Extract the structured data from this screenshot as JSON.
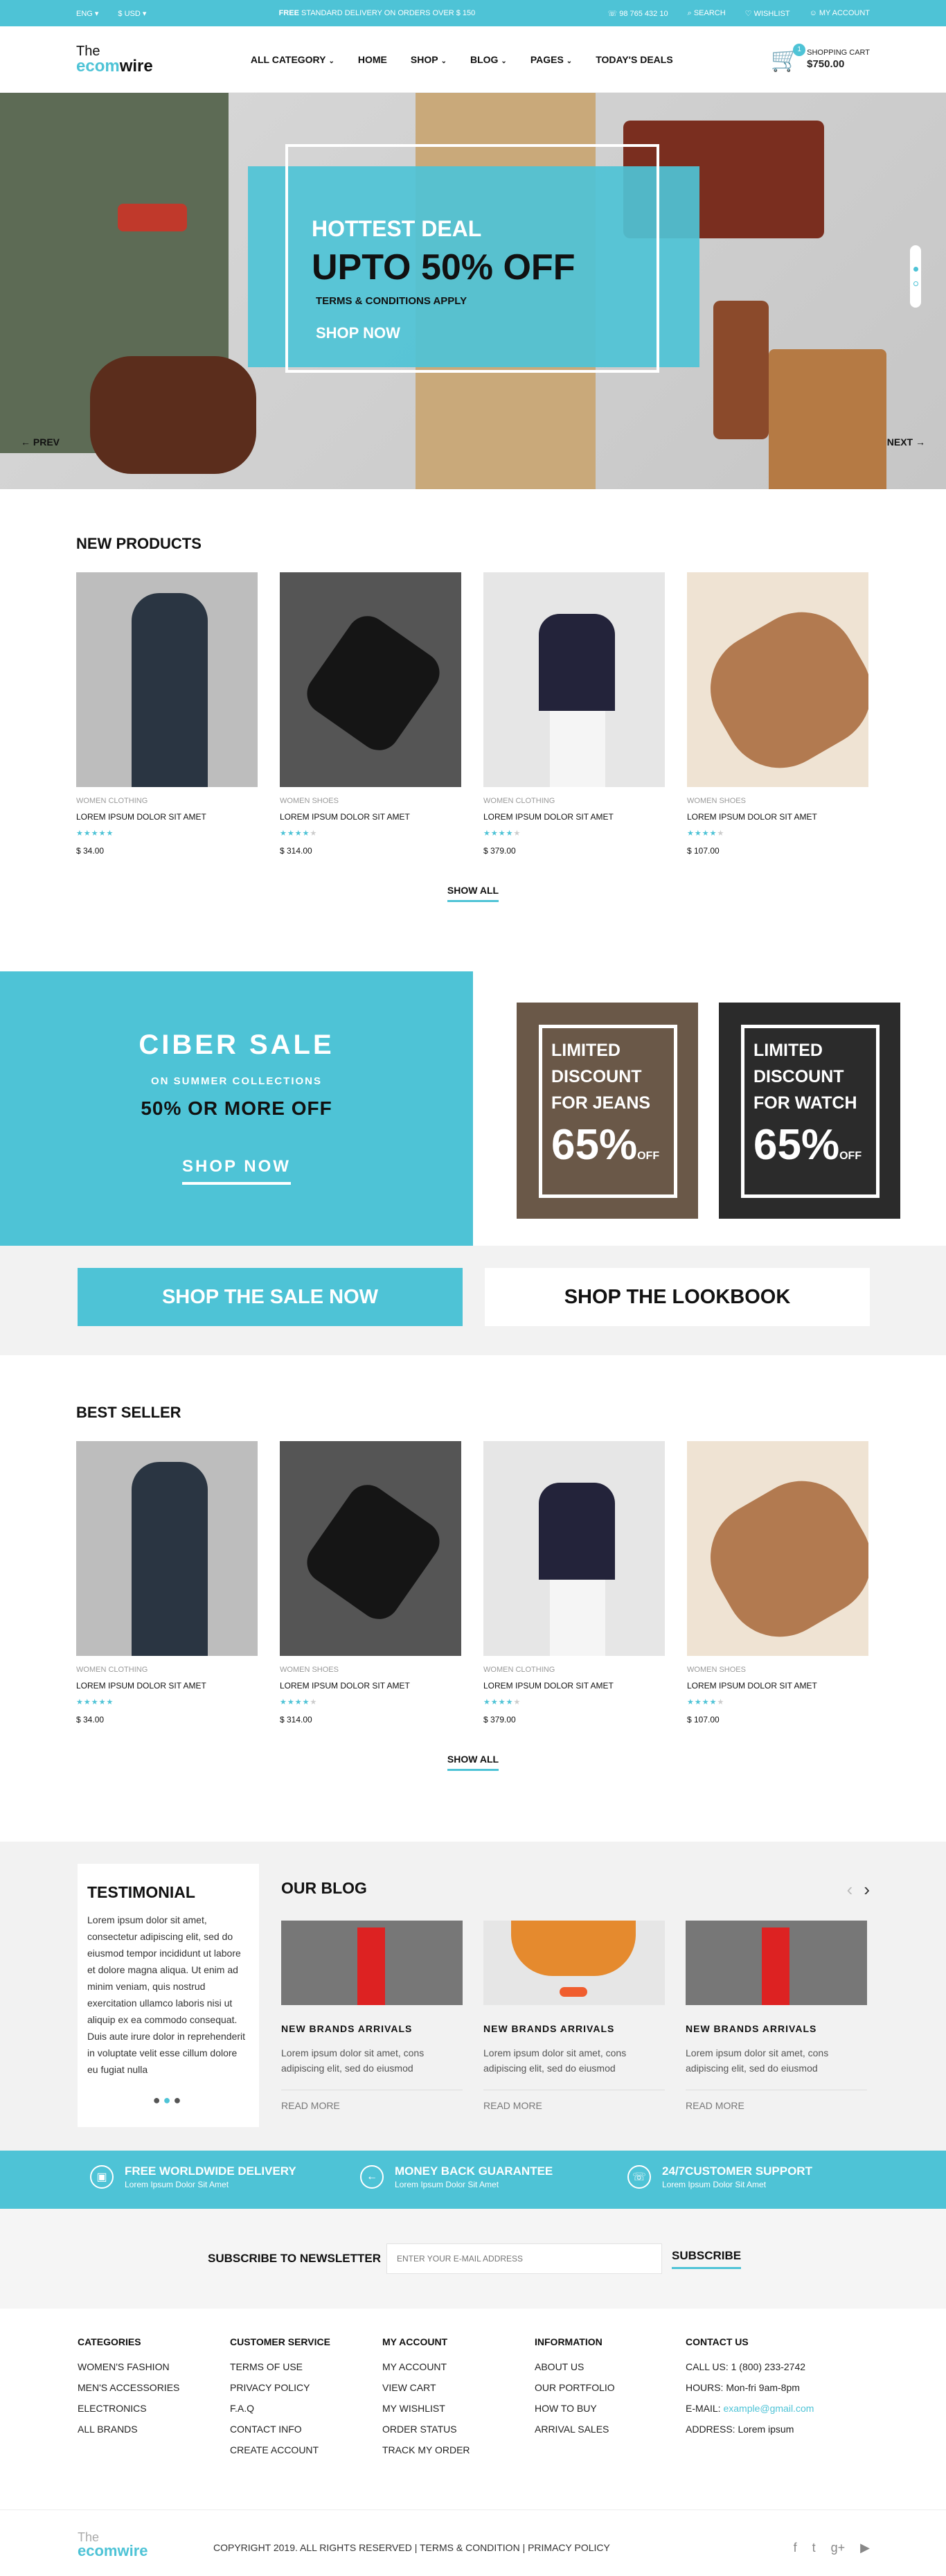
{
  "topbar": {
    "lang": "ENG ▾",
    "currency": "$ USD ▾",
    "free": "FREE",
    "delivery": "STANDARD DELIVERY ON ORDERS OVER $ 150",
    "phone": "98 765 432 10",
    "search": "SEARCH",
    "wishlist": "WISHLIST",
    "account": "MY ACCOUNT"
  },
  "header": {
    "logo_top": "The",
    "logo_main_a": "ecom",
    "logo_main_b": "wire",
    "nav": [
      "ALL CATEGORY",
      "HOME",
      "SHOP",
      "BLOG",
      "PAGES",
      "TODAY'S DEALS"
    ],
    "cart_count": "1",
    "cart_label": "SHOPPING CART",
    "cart_amount": "$750.00"
  },
  "hero": {
    "line1": "HOTTEST DEAL",
    "line2": "UPTO 50% OFF",
    "line3": "TERMS & CONDITIONS APPLY",
    "cta": "SHOP NOW",
    "prev": "← PREV",
    "next": "NEXT →"
  },
  "new_products": {
    "title": "NEW PRODUCTS",
    "items": [
      {
        "cat": "WOMEN CLOTHING",
        "name": "LOREM IPSUM DOLOR SIT AMET",
        "rating": 5,
        "price": "$ 34.00"
      },
      {
        "cat": "WOMEN SHOES",
        "name": "LOREM IPSUM DOLOR SIT AMET",
        "rating": 4,
        "price": "$ 314.00"
      },
      {
        "cat": "WOMEN CLOTHING",
        "name": "LOREM IPSUM DOLOR SIT AMET",
        "rating": 4,
        "price": "$ 379.00"
      },
      {
        "cat": "WOMEN SHOES",
        "name": "LOREM IPSUM DOLOR SIT AMET",
        "rating": 4,
        "price": "$ 107.00"
      }
    ],
    "show_all": "SHOW ALL"
  },
  "sale": {
    "title": "CIBER SALE",
    "sub": "ON SUMMER COLLECTIONS",
    "offer": "50% OR MORE OFF",
    "cta": "SHOP NOW",
    "jeans_text": [
      "LIMITED",
      "DISCOUNT",
      "FOR JEANS"
    ],
    "watch_text": [
      "LIMITED",
      "DISCOUNT",
      "FOR WATCH"
    ],
    "percent": "65%",
    "off": "OFF",
    "sale_btn": "SHOP THE SALE NOW",
    "lookbook_btn": "SHOP THE LOOKBOOK"
  },
  "best_seller": {
    "title": "BEST SELLER",
    "items": [
      {
        "cat": "WOMEN CLOTHING",
        "name": "LOREM IPSUM DOLOR SIT AMET",
        "rating": 5,
        "price": "$ 34.00"
      },
      {
        "cat": "WOMEN SHOES",
        "name": "LOREM IPSUM DOLOR SIT AMET",
        "rating": 4,
        "price": "$ 314.00"
      },
      {
        "cat": "WOMEN CLOTHING",
        "name": "LOREM IPSUM DOLOR SIT AMET",
        "rating": 4,
        "price": "$ 379.00"
      },
      {
        "cat": "WOMEN SHOES",
        "name": "LOREM IPSUM DOLOR SIT AMET",
        "rating": 4,
        "price": "$ 107.00"
      }
    ],
    "show_all": "SHOW ALL"
  },
  "testimonial": {
    "title": "TESTIMONIAL",
    "body": "Lorem ipsum dolor sit amet, consectetur adipiscing elit, sed do eiusmod tempor incididunt ut labore et dolore magna aliqua. Ut enim ad minim veniam, quis nostrud exercitation ullamco laboris nisi ut aliquip ex ea commodo consequat. Duis aute irure dolor in reprehenderit in voluptate velit esse cillum dolore eu fugiat nulla"
  },
  "blog": {
    "title": "OUR BLOG",
    "posts": [
      {
        "title": "NEW BRANDS ARRIVALS",
        "text": "Lorem ipsum dolor sit amet, cons adipiscing elit, sed do eiusmod",
        "more": "READ MORE"
      },
      {
        "title": "NEW BRANDS ARRIVALS",
        "text": "Lorem ipsum dolor sit amet, cons adipiscing elit, sed do eiusmod",
        "more": "READ MORE"
      },
      {
        "title": "NEW BRANDS ARRIVALS",
        "text": "Lorem ipsum dolor sit amet, cons adipiscing elit, sed do eiusmod",
        "more": "READ MORE"
      }
    ]
  },
  "features": [
    {
      "title": "FREE WORLDWIDE DELIVERY",
      "sub": "Lorem Ipsum Dolor Sit Amet",
      "icon": "box-icon"
    },
    {
      "title": "MONEY BACK GUARANTEE",
      "sub": "Lorem Ipsum Dolor Sit Amet",
      "icon": "arrow-left-circle-icon"
    },
    {
      "title": "24/7CUSTOMER SUPPORT",
      "sub": "Lorem Ipsum Dolor Sit Amet",
      "icon": "phone-icon"
    }
  ],
  "newsletter": {
    "label": "SUBSCRIBE TO NEWSLETTER",
    "placeholder": "ENTER YOUR E-MAIL ADDRESS",
    "button": "SUBSCRIBE"
  },
  "footer": {
    "columns": [
      {
        "title": "CATEGORIES",
        "items": [
          "WOMEN'S FASHION",
          "MEN'S ACCESSORIES",
          "ELECTRONICS",
          "ALL BRANDS"
        ]
      },
      {
        "title": "CUSTOMER SERVICE",
        "items": [
          "TERMS OF USE",
          "PRIVACY POLICY",
          "F.A.Q",
          "CONTACT INFO",
          "CREATE ACCOUNT"
        ]
      },
      {
        "title": "MY ACCOUNT",
        "items": [
          "MY ACCOUNT",
          "VIEW CART",
          "MY WISHLIST",
          "ORDER STATUS",
          "TRACK MY ORDER"
        ]
      },
      {
        "title": "INFORMATION",
        "items": [
          "ABOUT US",
          "OUR PORTFOLIO",
          "HOW TO BUY",
          "ARRIVAL SALES"
        ]
      }
    ],
    "contact_title": "CONTACT US",
    "call": "CALL US: 1 (800) 233-2742",
    "hours": "HOURS: Mon-fri 9am-8pm",
    "email_label": "E-MAIL: ",
    "email": "example@gmail.com",
    "address": "ADDRESS: Lorem ipsum",
    "copyright": "COPYRIGHT 2019. ALL RIGHTS RESERVED | TERMS & CONDITION | PRIMACY POLICY"
  },
  "colors": {
    "accent": "#4ec3d6"
  }
}
